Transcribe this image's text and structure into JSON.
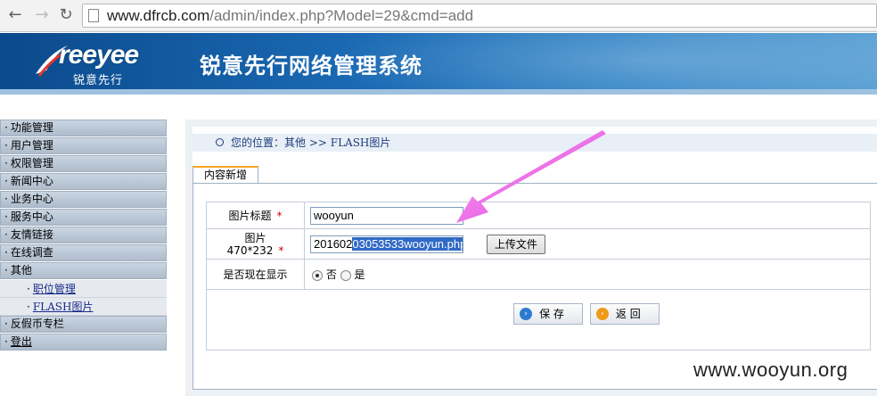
{
  "browser": {
    "url_host": "www.dfrcb.com",
    "url_path": "/admin/index.php?Model=29&cmd=add"
  },
  "header": {
    "brand_en": "reeyee",
    "brand_cn": "锐意先行",
    "system_title": "锐意先行网络管理系统"
  },
  "sidebar": {
    "bullet": "·",
    "items": [
      {
        "label": "功能管理"
      },
      {
        "label": "用户管理"
      },
      {
        "label": "权限管理"
      },
      {
        "label": "新闻中心"
      },
      {
        "label": "业务中心"
      },
      {
        "label": "服务中心"
      },
      {
        "label": "友情链接"
      },
      {
        "label": "在线调查"
      },
      {
        "label": "其他"
      }
    ],
    "sub_items": [
      {
        "label": "职位管理"
      },
      {
        "label": "FLASH图片"
      }
    ],
    "items_after": [
      {
        "label": "反假币专栏"
      },
      {
        "label": "登出"
      }
    ]
  },
  "breadcrumb": {
    "text": "您的位置：其他  >>  FLASH图片"
  },
  "tab": {
    "label": "内容新增"
  },
  "form": {
    "title_label": "图片标题",
    "title_value": "wooyun",
    "image_label": "图片",
    "image_size": "470*232",
    "image_value_prefix": "201602",
    "image_value_selected": "03053533wooyun.php",
    "upload_button": "上传文件",
    "show_label": "是否现在显示",
    "option_no": "否",
    "option_yes": "是",
    "required_mark": "*",
    "save_button": "保 存",
    "back_button": "返 回"
  },
  "watermark": "www.wooyun.org",
  "colors": {
    "annotation_arrow": "#e53de0",
    "banner": "#1a69b3",
    "required": "#d40000"
  }
}
